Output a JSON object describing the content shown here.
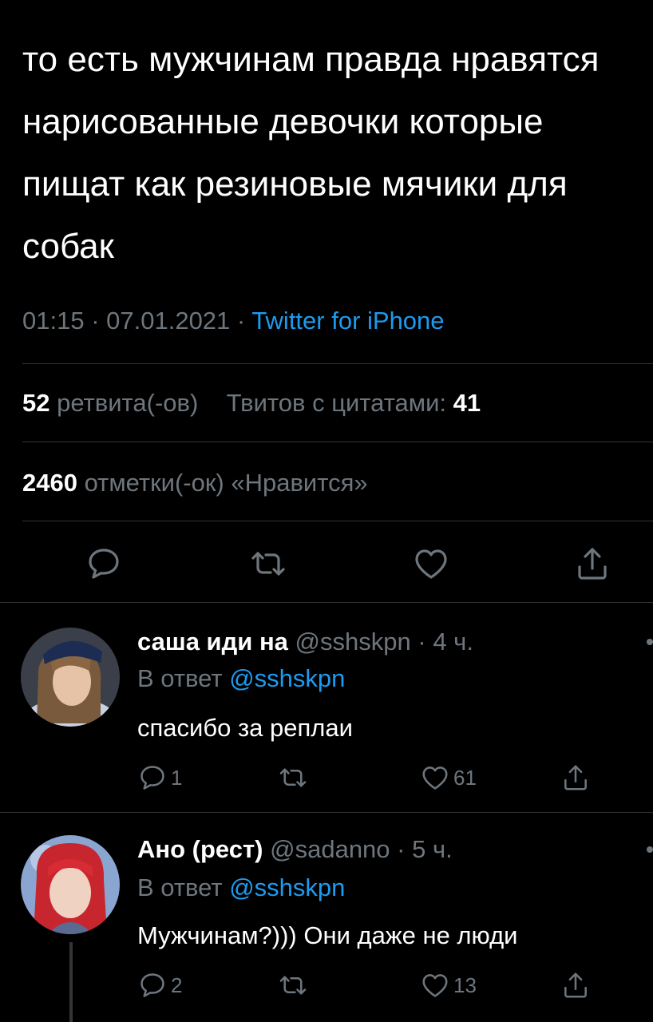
{
  "tweet": {
    "text": "то есть мужчинам правда нравятся нарисованные девочки которые пищат как резиновые мячики для собак",
    "time": "01:15",
    "date": "07.01.2021",
    "source": "Twitter for iPhone",
    "retweets_count": "52",
    "retweets_label": "ретвита(-ов)",
    "quotes_label": "Твитов с цитатами:",
    "quotes_count": "41",
    "likes_count": "2460",
    "likes_label": "отметки(-ок) «Нравится»"
  },
  "replies": [
    {
      "name": "саша иди на",
      "handle": "@sshskpn",
      "time": "4 ч.",
      "reply_to_label": "В ответ",
      "reply_to": "@sshskpn",
      "text": "спасибо за реплаи",
      "reply_count": "1",
      "retweet_count": "",
      "like_count": "61"
    },
    {
      "name": "Ано (рест)",
      "handle": "@sadanno",
      "time": "5 ч.",
      "reply_to_label": "В ответ",
      "reply_to": "@sshskpn",
      "text": "Мужчинам?))) Они даже не люди",
      "reply_count": "2",
      "retweet_count": "",
      "like_count": "13"
    }
  ],
  "icons": {
    "reply": "reply-icon",
    "retweet": "retweet-icon",
    "like": "heart-icon",
    "share": "share-icon"
  },
  "colors": {
    "background": "#000000",
    "text": "#ffffff",
    "secondary": "#6e767d",
    "accent": "#1d9bf0",
    "divider": "#2f3336"
  }
}
